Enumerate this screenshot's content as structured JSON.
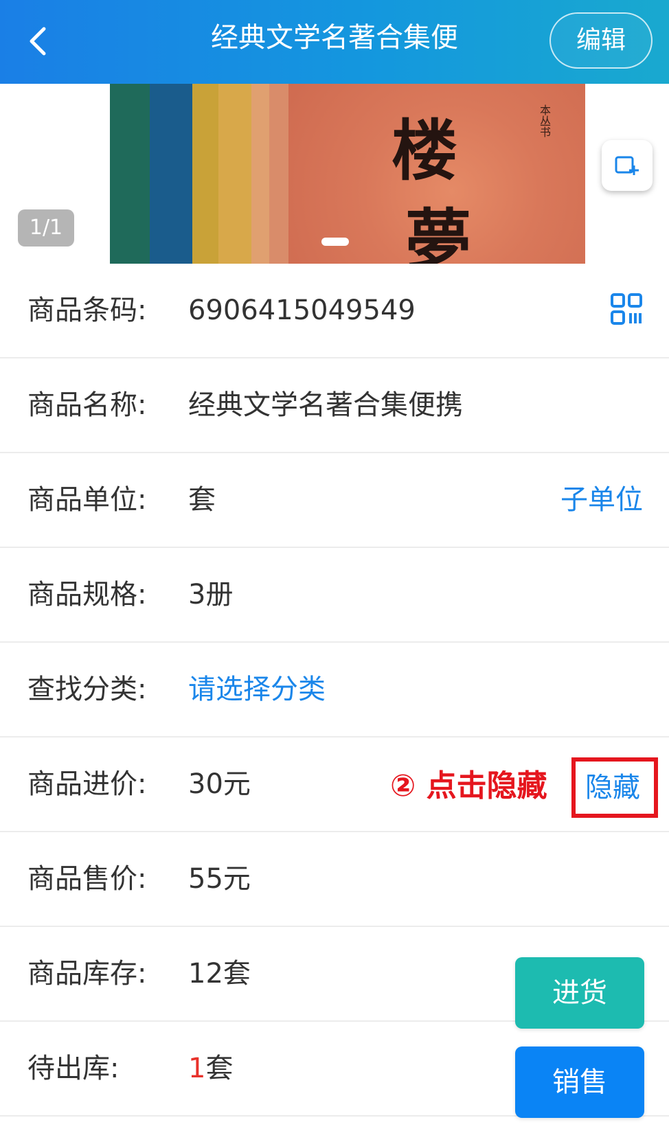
{
  "header": {
    "title": "经典文学名著合集便",
    "edit_label": "编辑"
  },
  "gallery": {
    "page_counter": "1/1",
    "cover_chars": [
      "楼",
      "夢"
    ],
    "cover_small_text": "本丛书"
  },
  "fields": [
    {
      "label": "商品条码:",
      "value": "6906415049549"
    },
    {
      "label": "商品名称:",
      "value": "经典文学名著合集便携"
    },
    {
      "label": "商品单位:",
      "value": "套",
      "action": "子单位"
    },
    {
      "label": "商品规格:",
      "value": "3册"
    },
    {
      "label": "查找分类:",
      "value": "请选择分类"
    },
    {
      "label": "商品进价:",
      "value": "30元",
      "action": "隐藏"
    },
    {
      "label": "商品售价:",
      "value": "55元"
    },
    {
      "label": "商品库存:",
      "value": "12套"
    },
    {
      "label": "待出库:",
      "qty": "1",
      "unit": "套"
    }
  ],
  "annotation": "② 点击隐藏",
  "buttons": {
    "restock": "进货",
    "sell": "销售"
  },
  "colors": {
    "header_start": "#1a7fe6",
    "header_end": "#19a9cf",
    "link_blue": "#1a86ea",
    "restock_teal": "#1dbbb0",
    "sell_blue": "#0a84f5",
    "annotation_red": "#e5161e",
    "qty_red": "#e8322b"
  }
}
